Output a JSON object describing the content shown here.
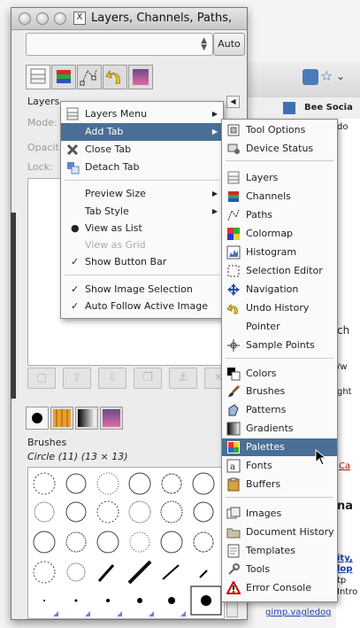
{
  "window": {
    "title": "Layers, Channels, Paths,",
    "auto_label": "Auto"
  },
  "dock": {
    "panel_title": "Layers",
    "mode_label": "Mode:",
    "opacity_label": "Opacit",
    "lock_label": "Lock:",
    "brushes_title": "Brushes",
    "brush_name": "Circle (11) (13 × 13)"
  },
  "menu1": {
    "items": [
      {
        "label": "Layers Menu",
        "submenu": true,
        "icon": "layers-menu-icon"
      },
      {
        "label": "Add Tab",
        "submenu": true,
        "selected": true
      },
      {
        "label": "Close Tab",
        "icon": "close-x-icon"
      },
      {
        "label": "Detach Tab",
        "icon": "detach-icon"
      },
      {
        "label": "Preview Size",
        "submenu": true
      },
      {
        "label": "Tab Style",
        "submenu": true
      },
      {
        "label": "View as List",
        "mark": "●"
      },
      {
        "label": "View as Grid",
        "disabled": true
      },
      {
        "label": "Show Button Bar",
        "mark": "✓"
      },
      {
        "label": "Show Image Selection",
        "mark": "✓"
      },
      {
        "label": "Auto Follow Active Image",
        "mark": "✓"
      }
    ]
  },
  "menu2": {
    "items": [
      {
        "label": "Tool Options",
        "icon": "tool-options-icon"
      },
      {
        "label": "Device Status",
        "icon": "device-status-icon"
      },
      {
        "label": "Layers",
        "icon": "layers-icon"
      },
      {
        "label": "Channels",
        "icon": "channels-icon"
      },
      {
        "label": "Paths",
        "icon": "paths-icon"
      },
      {
        "label": "Colormap",
        "icon": "colormap-icon"
      },
      {
        "label": "Histogram",
        "icon": "histogram-icon"
      },
      {
        "label": "Selection Editor",
        "icon": "selection-editor-icon"
      },
      {
        "label": "Navigation",
        "icon": "navigation-icon"
      },
      {
        "label": "Undo History",
        "icon": "undo-history-icon"
      },
      {
        "label": "Pointer",
        "icon": "pointer-icon"
      },
      {
        "label": "Sample Points",
        "icon": "sample-points-icon"
      },
      {
        "label": "Colors",
        "icon": "colors-icon"
      },
      {
        "label": "Brushes",
        "icon": "brushes-icon"
      },
      {
        "label": "Patterns",
        "icon": "patterns-icon"
      },
      {
        "label": "Gradients",
        "icon": "gradients-icon"
      },
      {
        "label": "Palettes",
        "icon": "palettes-icon",
        "selected": true
      },
      {
        "label": "Fonts",
        "icon": "fonts-icon"
      },
      {
        "label": "Buffers",
        "icon": "buffers-icon"
      },
      {
        "label": "Images",
        "icon": "images-icon"
      },
      {
        "label": "Document History",
        "icon": "document-history-icon"
      },
      {
        "label": "Templates",
        "icon": "templates-icon"
      },
      {
        "label": "Tools",
        "icon": "tools-icon"
      },
      {
        "label": "Error Console",
        "icon": "error-console-icon"
      }
    ]
  },
  "background_browser": {
    "bookmark": "Bee Socia",
    "text_fragments": [
      "do",
      "ch",
      "/w",
      "ght",
      "na",
      "ity,",
      "lop",
      "Ca",
      "tp",
      "Intro",
      "gimp.vagledog"
    ],
    "accent": "#1a3ea8"
  }
}
